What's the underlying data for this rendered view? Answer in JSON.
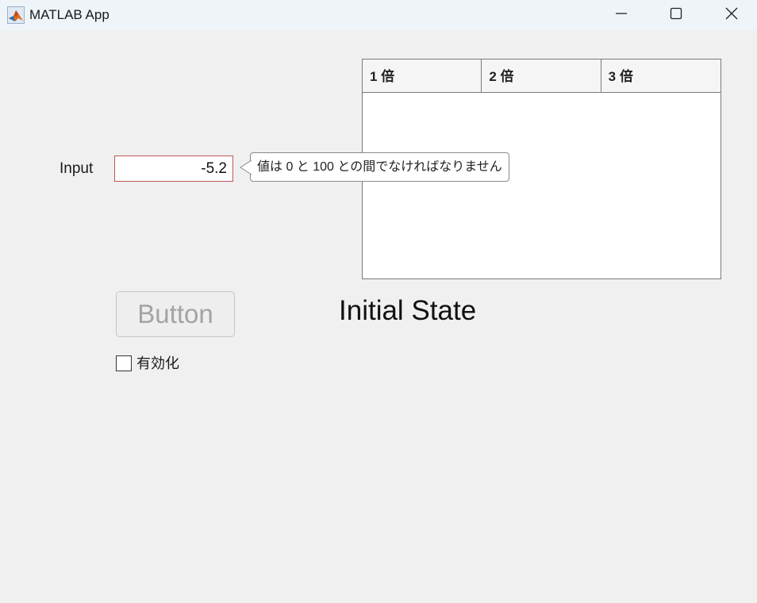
{
  "window": {
    "title": "MATLAB App",
    "minimize_icon": "minimize-icon",
    "maximize_icon": "maximize-icon",
    "close_icon": "close-icon",
    "app_icon": "matlab-logo-icon"
  },
  "form": {
    "input_label": "Input",
    "input_value": "-5.2",
    "tooltip_text": "値は 0 と 100 との間でなければなりません",
    "button_label": "Button",
    "button_enabled": false,
    "status_text": "Initial State",
    "checkbox_label": "有効化",
    "checkbox_checked": false
  },
  "table": {
    "columns": [
      "1 倍",
      "2 倍",
      "3 倍"
    ],
    "rows": []
  },
  "colors": {
    "background": "#f0f0f0",
    "titlebar": "#eff4f9",
    "error_border": "#c25454",
    "disabled_text": "#a3a3a3"
  }
}
